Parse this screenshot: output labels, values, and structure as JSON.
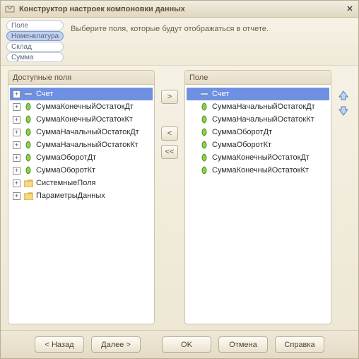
{
  "window": {
    "title": "Конструктор настроек компоновки данных"
  },
  "topband": {
    "pills": [
      "Поле",
      "Номенклатура",
      "Склад",
      "Сумма"
    ],
    "pill_selected_index": 1,
    "hint": "Выберите поля, которые будут отображаться в отчете."
  },
  "left_panel": {
    "header": "Доступные поля",
    "items": [
      {
        "label": "Счет",
        "icon": "minus",
        "expander": "+",
        "selected": true,
        "indent": 0
      },
      {
        "label": "СуммаКонечныйОстатокДт",
        "icon": "leaf",
        "expander": "+",
        "indent": 0
      },
      {
        "label": "СуммаКонечныйОстатокКт",
        "icon": "leaf",
        "expander": "+",
        "indent": 0
      },
      {
        "label": "СуммаНачальныйОстатокДт",
        "icon": "leaf",
        "expander": "+",
        "indent": 0
      },
      {
        "label": "СуммаНачальныйОстатокКт",
        "icon": "leaf",
        "expander": "+",
        "indent": 0
      },
      {
        "label": "СуммаОборотДт",
        "icon": "leaf",
        "expander": "+",
        "indent": 0
      },
      {
        "label": "СуммаОборотКт",
        "icon": "leaf",
        "expander": "+",
        "indent": 0
      },
      {
        "label": "СистемныеПоля",
        "icon": "folder",
        "expander": "+",
        "indent": 0
      },
      {
        "label": "ПараметрыДанных",
        "icon": "folder",
        "expander": "+",
        "indent": 0
      }
    ]
  },
  "right_panel": {
    "header": "Поле",
    "items": [
      {
        "label": "Счет",
        "icon": "minus",
        "selected": true,
        "indent": 1
      },
      {
        "label": "СуммаНачальныйОстатокДт",
        "icon": "leaf",
        "indent": 1
      },
      {
        "label": "СуммаНачальныйОстатокКт",
        "icon": "leaf",
        "indent": 1
      },
      {
        "label": "СуммаОборотДт",
        "icon": "leaf",
        "indent": 1
      },
      {
        "label": "СуммаОборотКт",
        "icon": "leaf",
        "indent": 1
      },
      {
        "label": "СуммаКонечныйОстатокДт",
        "icon": "leaf",
        "indent": 1
      },
      {
        "label": "СуммаКонечныйОстатокКт",
        "icon": "leaf",
        "indent": 1
      }
    ]
  },
  "move_buttons": {
    "add": ">",
    "remove": "<",
    "remove_all": "<<"
  },
  "footer": {
    "back": "< Назад",
    "next": "Далее >",
    "ok": "OK",
    "cancel": "Отмена",
    "help": "Справка"
  }
}
